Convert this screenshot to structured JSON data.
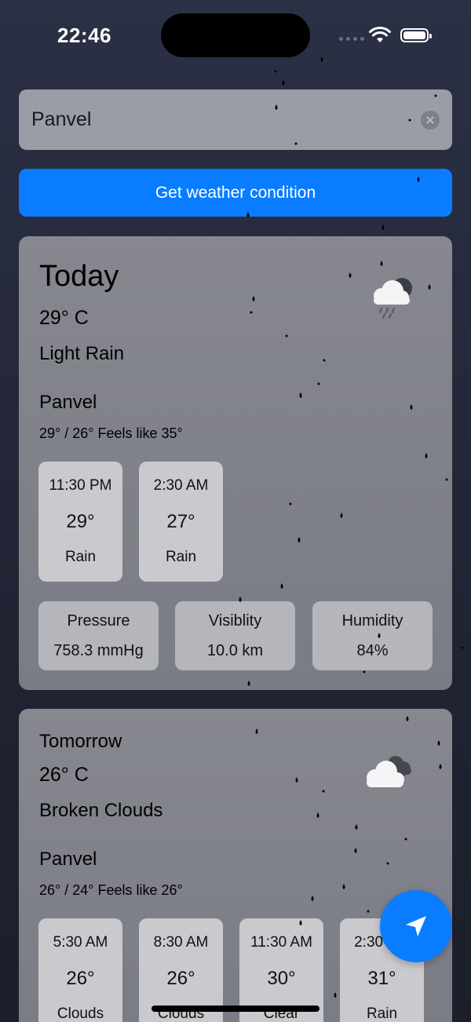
{
  "status": {
    "time": "22:46"
  },
  "search": {
    "value": "Panvel"
  },
  "action": {
    "label": "Get weather condition"
  },
  "today": {
    "title": "Today",
    "temp": "29° C",
    "condition": "Light Rain",
    "city": "Panvel",
    "range": "29° / 26° Feels like 35°",
    "icon": "cloud-rain-icon",
    "hourly": [
      {
        "time": "11:30 PM",
        "temp": "29°",
        "cond": "Rain"
      },
      {
        "time": "2:30 AM",
        "temp": "27°",
        "cond": "Rain"
      }
    ],
    "stats": [
      {
        "label": "Pressure",
        "value": "758.3 mmHg"
      },
      {
        "label": "Visiblity",
        "value": "10.0 km"
      },
      {
        "label": "Humidity",
        "value": "84%"
      }
    ]
  },
  "tomorrow": {
    "title": "Tomorrow",
    "temp": "26° C",
    "condition": "Broken Clouds",
    "city": "Panvel",
    "range": "26° / 24° Feels like 26°",
    "icon": "broken-clouds-icon",
    "hourly": [
      {
        "time": "5:30 AM",
        "temp": "26°",
        "cond": "Clouds"
      },
      {
        "time": "8:30 AM",
        "temp": "26°",
        "cond": "Clouds"
      },
      {
        "time": "11:30 AM",
        "temp": "30°",
        "cond": "Clear"
      },
      {
        "time": "2:30 PM",
        "temp": "31°",
        "cond": "Rain"
      }
    ]
  },
  "fab": {
    "icon": "location-arrow-icon"
  },
  "colors": {
    "accent": "#0a7cff",
    "card": "#7c7e87",
    "tile": "#c9c9ce"
  }
}
